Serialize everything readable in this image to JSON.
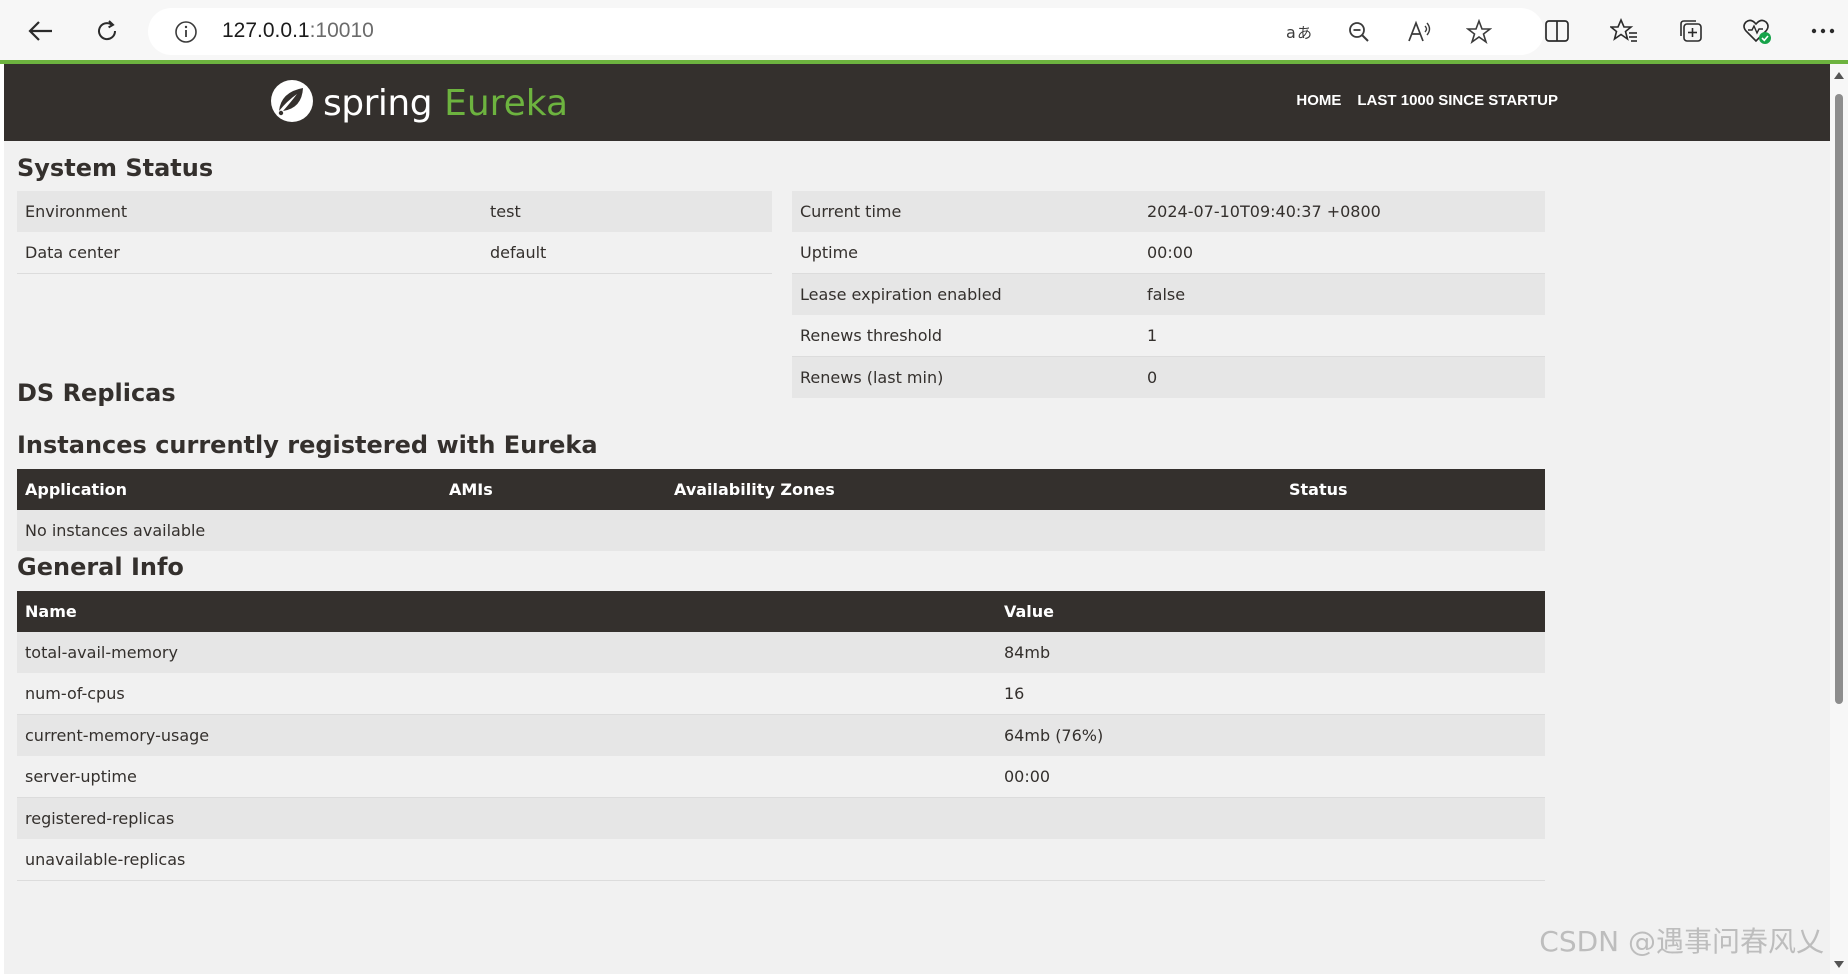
{
  "browser": {
    "url_host": "127.0.0.1",
    "url_port": ":10010"
  },
  "nav": {
    "brand_spring": "spring",
    "brand_eureka": "Eureka",
    "home": "HOME",
    "last1000": "LAST 1000 SINCE STARTUP"
  },
  "system_status": {
    "title": "System Status",
    "left": [
      {
        "label": "Environment",
        "value": "test"
      },
      {
        "label": "Data center",
        "value": "default"
      }
    ],
    "right": [
      {
        "label": "Current time",
        "value": "2024-07-10T09:40:37 +0800"
      },
      {
        "label": "Uptime",
        "value": "00:00"
      },
      {
        "label": "Lease expiration enabled",
        "value": "false"
      },
      {
        "label": "Renews threshold",
        "value": "1"
      },
      {
        "label": "Renews (last min)",
        "value": "0"
      }
    ]
  },
  "ds_replicas": {
    "title": "DS Replicas"
  },
  "instances": {
    "title": "Instances currently registered with Eureka",
    "headers": [
      "Application",
      "AMIs",
      "Availability Zones",
      "Status"
    ],
    "empty": "No instances available"
  },
  "general_info": {
    "title": "General Info",
    "headers": [
      "Name",
      "Value"
    ],
    "rows": [
      {
        "name": "total-avail-memory",
        "value": "84mb"
      },
      {
        "name": "num-of-cpus",
        "value": "16"
      },
      {
        "name": "current-memory-usage",
        "value": "64mb (76%)"
      },
      {
        "name": "server-uptime",
        "value": "00:00"
      },
      {
        "name": "registered-replicas",
        "value": ""
      },
      {
        "name": "unavailable-replicas",
        "value": ""
      }
    ]
  },
  "watermark": "CSDN @遇事问春风乂"
}
